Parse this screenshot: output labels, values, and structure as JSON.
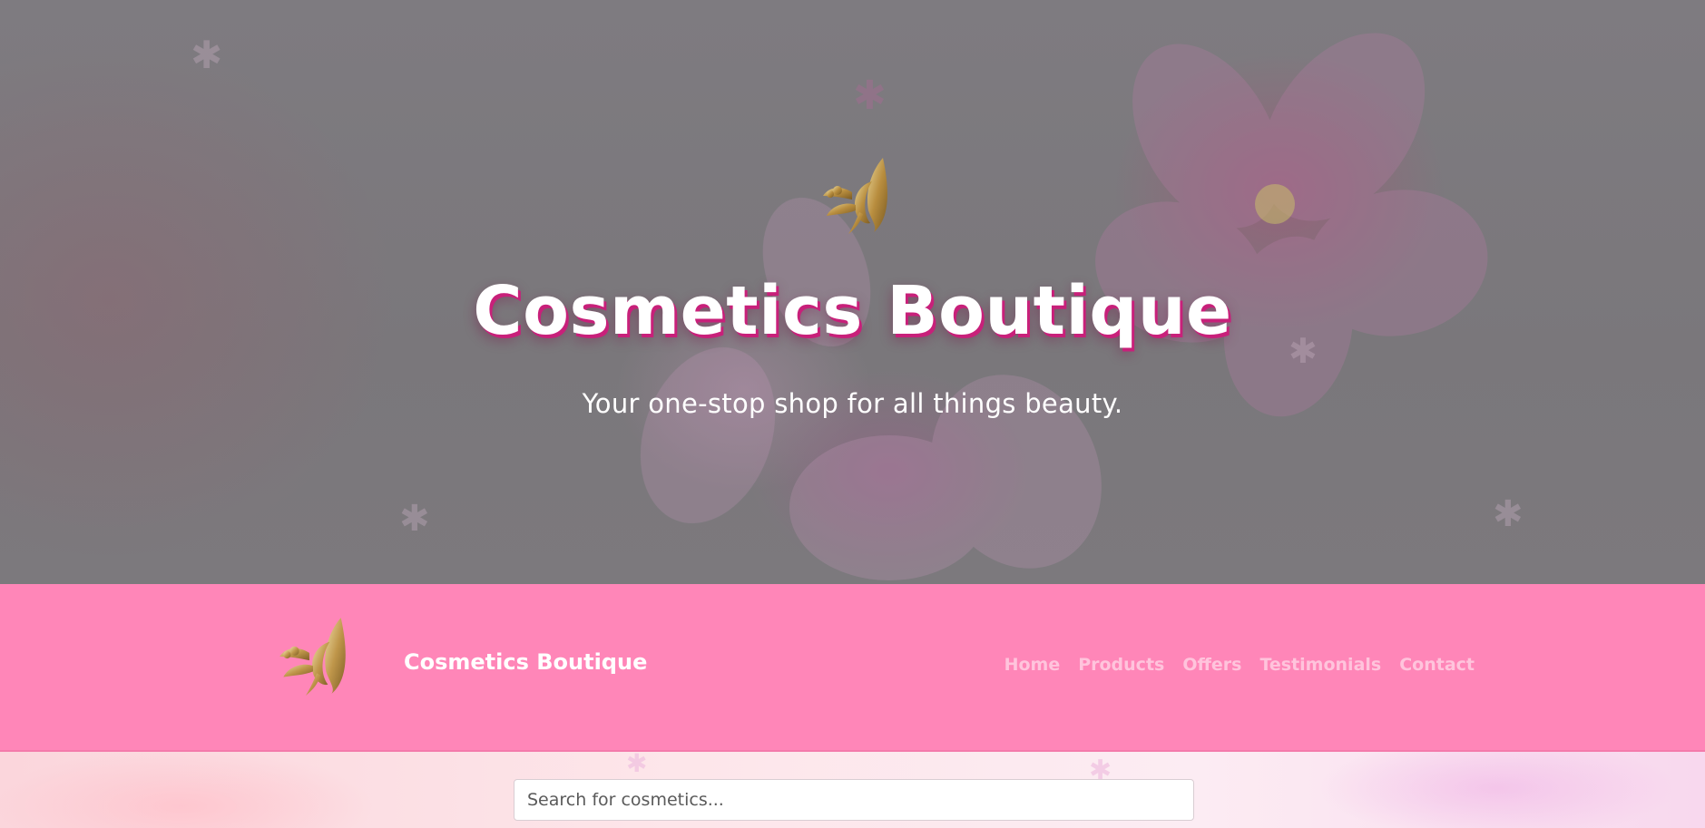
{
  "hero": {
    "title": "Cosmetics Boutique",
    "subtitle": "Your one-stop shop for all things beauty.",
    "logo_icon": "butterfly-face-logo-icon"
  },
  "navbar": {
    "brand": "Cosmetics Boutique",
    "logo_icon": "butterfly-face-logo-icon",
    "links": [
      {
        "label": "Home"
      },
      {
        "label": "Products"
      },
      {
        "label": "Offers"
      },
      {
        "label": "Testimonials"
      },
      {
        "label": "Contact"
      }
    ]
  },
  "search": {
    "placeholder": "Search for cosmetics...",
    "value": ""
  },
  "colors": {
    "navbar_bg": "#ff86b8",
    "nav_link": "#ffc4dc",
    "title_shadow": "#c8207a",
    "gold": "#c9a45a"
  }
}
